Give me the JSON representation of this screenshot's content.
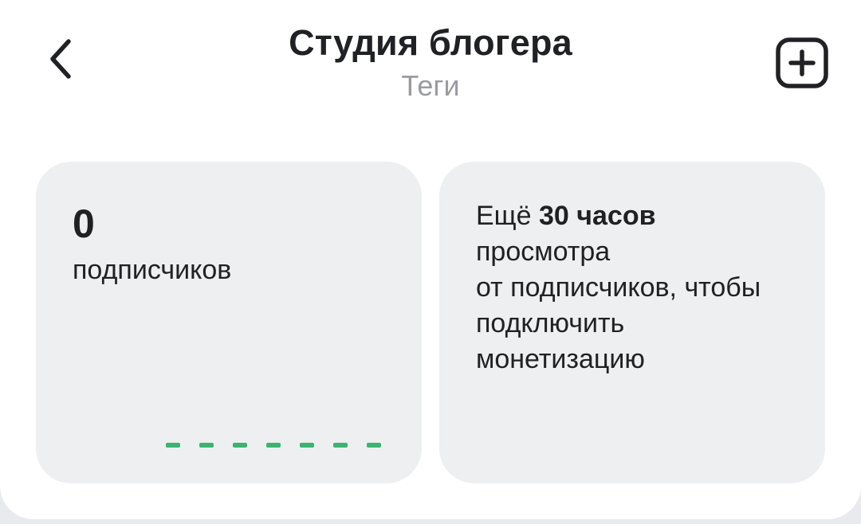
{
  "header": {
    "title": "Студия блогера",
    "subtitle": "Теги",
    "back_icon": "chevron-left-icon",
    "add_icon": "plus-square-icon"
  },
  "subscribers_card": {
    "count": "0",
    "label": "подписчиков",
    "accent_color": "#3cb371"
  },
  "monetization_card": {
    "prefix": "Ещё ",
    "highlight": "30 часов",
    "lines": [
      "просмотра",
      "от подписчиков, чтобы",
      "подключить",
      "монетизацию"
    ]
  }
}
